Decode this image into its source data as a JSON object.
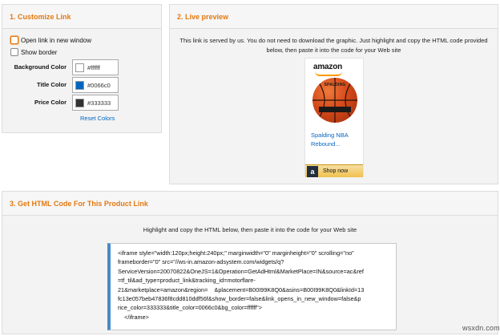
{
  "customize": {
    "title": "1. Customize Link",
    "open_new_window_label": "Open link in new window",
    "show_border_label": "Show border",
    "background_color": {
      "label": "Background Color",
      "value": "#ffffff",
      "swatch": "#ffffff"
    },
    "title_color": {
      "label": "Title Color",
      "value": "#0066c0",
      "swatch": "#0066c0"
    },
    "price_color": {
      "label": "Price Color",
      "value": "#333333",
      "swatch": "#333333"
    },
    "reset_label": "Reset Colors"
  },
  "preview": {
    "title": "2. Live preview",
    "served_text": "This link is served by us. You do not need to download the graphic. Just highlight and copy the HTML code provided below, then paste it into the code for your Web site",
    "logo_text": "amazon",
    "ball_brand": "SPALDING",
    "product_title": "Spalding NBA Rebound...",
    "shop_icon": "a",
    "shop_label": "Shop now"
  },
  "html_code": {
    "title": "3. Get HTML Code For This Product Link",
    "instruction": "Highlight and copy the HTML below, then paste it into the code for your Web site",
    "code": "<iframe style=\"width:120px;height:240px;\" marginwidth=\"0\" marginheight=\"0\" scrolling=\"no\"\nframeborder=\"0\" src=\"//ws-in.amazon-adsystem.com/widgets/q?\nServiceVersion=20070822&OneJS=1&Operation=GetAdHtml&MarketPlace=IN&source=ac&ref\n=tf_til&ad_type=product_link&tracking_id=motorflare-\n21&marketplace=amazon&region=    &placement=B00I99K8Q0&asins=B00I99K8Q0&linkId=13\nfc13e057beb47836f8cdd810ddf56f&show_border=false&link_opens_in_new_window=false&p\nrice_color=333333&title_color=0066c0&bg_color=ffffff\">\n    </iframe>"
  },
  "watermark": "wsxdn.com"
}
